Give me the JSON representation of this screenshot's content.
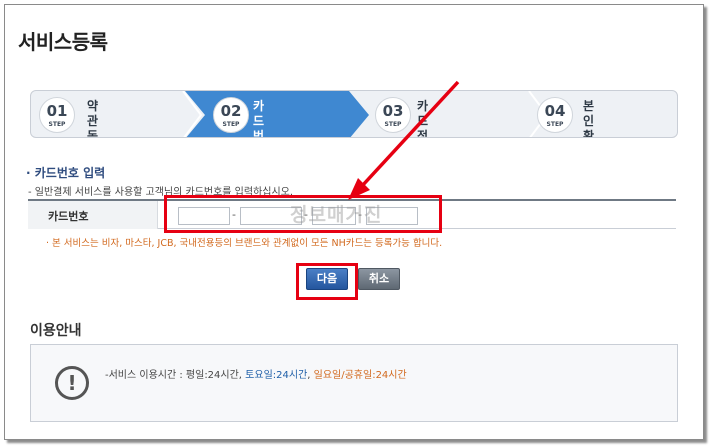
{
  "page_title": "서비스등록",
  "steps": [
    {
      "num": "01",
      "word": "STEP",
      "label": "약관동의",
      "active": false
    },
    {
      "num": "02",
      "word": "STEP",
      "label": "카드번호\n입력",
      "active": true
    },
    {
      "num": "03",
      "word": "STEP",
      "label": "카드정보입력\n비밀번호 생성",
      "active": false
    },
    {
      "num": "04",
      "word": "STEP",
      "label": "본인확인",
      "active": false
    }
  ],
  "card_section": {
    "heading": "· 카드번호 입력",
    "description": "- 일반결제 서비스를 사용할 고객님의 카드번호를 입력하십시오.",
    "field_label": "카드번호",
    "inputs": [
      {
        "value": "",
        "placeholder": ""
      },
      {
        "value": "",
        "placeholder": ""
      },
      {
        "value": "",
        "placeholder": ""
      },
      {
        "value": "",
        "placeholder": ""
      }
    ],
    "separator": "-",
    "notice": "· 본 서비스는 비자, 마스타, JCB, 국내전용등의 브랜드와 관계없이 모든 NH카드는 등록가능 합니다."
  },
  "watermark": "정보매거진",
  "buttons": {
    "next": "다음",
    "cancel": "취소"
  },
  "info": {
    "title": "이용안내",
    "icon": "!",
    "text_prefix": "-서비스 이용시간 : 평일:24시간, ",
    "text_saturday": "토요일:24시간",
    "text_sep": ", ",
    "text_holiday": "일요일/공휴일:24시간"
  },
  "colors": {
    "accent": "#3f88d1",
    "annotation": "#e60012",
    "notice": "#d2691e",
    "next_button": "#2a5ea8"
  }
}
